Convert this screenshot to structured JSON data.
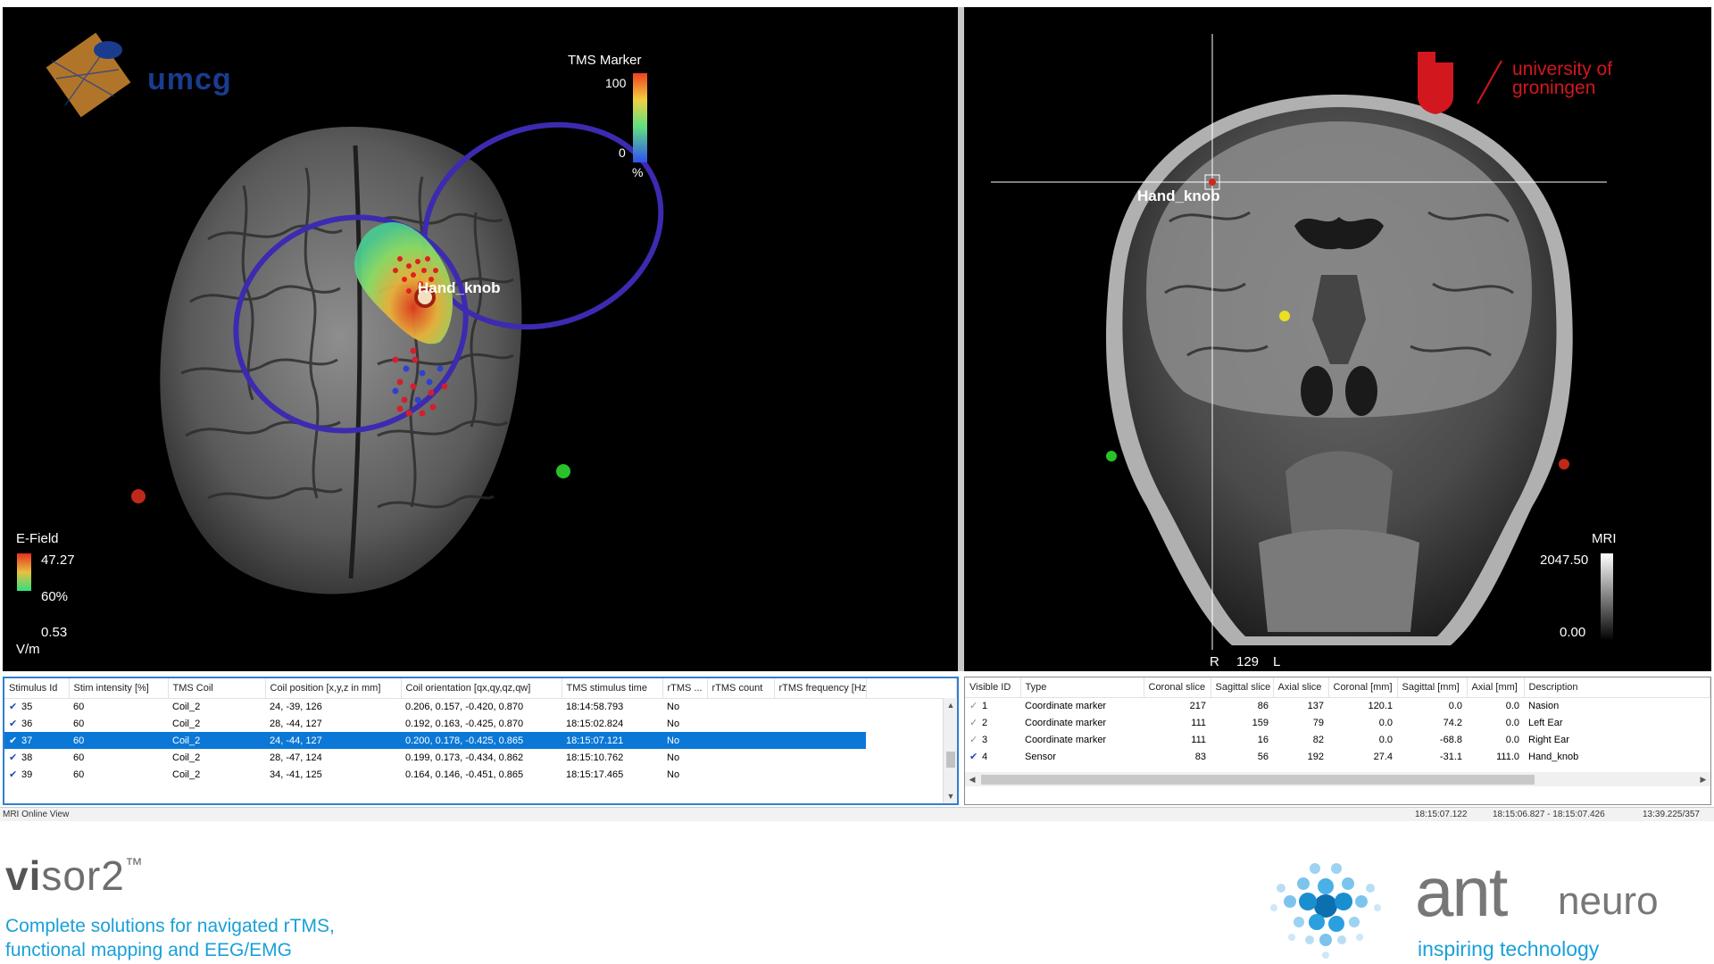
{
  "left_view": {
    "logo_text": "umcg",
    "tms_marker": {
      "title": "TMS Marker",
      "max": "100",
      "min": "0",
      "unit": "%"
    },
    "efield": {
      "title": "E-Field",
      "max": "47.27",
      "mid": "60%",
      "min": "0.53",
      "unit": "V/m"
    },
    "target_label": "Hand_knob"
  },
  "right_view": {
    "logo_line1": "university of",
    "logo_line2": "groningen",
    "target_label": "Hand_knob",
    "mri_scale": {
      "title": "MRI",
      "max": "2047.50",
      "min": "0.00"
    },
    "slice_readout": {
      "left": "R",
      "value": "129",
      "right": "L"
    }
  },
  "stimulus_table": {
    "columns": [
      "Stimulus Id",
      "Stim intensity [%]",
      "TMS Coil",
      "Coil position [x,y,z in mm]",
      "Coil orientation [qx,qy,qz,qw]",
      "TMS stimulus time",
      "rTMS ...",
      "rTMS count",
      "rTMS frequency [Hz]"
    ],
    "rows": [
      {
        "id": "35",
        "intensity": "60",
        "coil": "Coil_2",
        "position": "24, -39, 126",
        "orientation": "0.206, 0.157, -0.420, 0.870",
        "time": "18:14:58.793",
        "rtms": "No"
      },
      {
        "id": "36",
        "intensity": "60",
        "coil": "Coil_2",
        "position": "28, -44, 127",
        "orientation": "0.192, 0.163, -0.425, 0.870",
        "time": "18:15:02.824",
        "rtms": "No"
      },
      {
        "id": "37",
        "intensity": "60",
        "coil": "Coil_2",
        "position": "24, -44, 127",
        "orientation": "0.200, 0.178, -0.425, 0.865",
        "time": "18:15:07.121",
        "rtms": "No"
      },
      {
        "id": "38",
        "intensity": "60",
        "coil": "Coil_2",
        "position": "28, -47, 124",
        "orientation": "0.199, 0.173, -0.434, 0.862",
        "time": "18:15:10.762",
        "rtms": "No"
      },
      {
        "id": "39",
        "intensity": "60",
        "coil": "Coil_2",
        "position": "34, -41, 125",
        "orientation": "0.164, 0.146, -0.451, 0.865",
        "time": "18:15:17.465",
        "rtms": "No"
      }
    ]
  },
  "marker_table": {
    "columns": [
      "Visible ID",
      "Type",
      "Coronal slice",
      "Sagittal slice",
      "Axial slice",
      "Coronal [mm]",
      "Sagittal [mm]",
      "Axial [mm]",
      "Description"
    ],
    "rows": [
      {
        "id": "1",
        "type": "Coordinate marker",
        "coronal_slice": "217",
        "sagittal_slice": "86",
        "axial_slice": "137",
        "coronal_mm": "120.1",
        "sagittal_mm": "0.0",
        "axial_mm": "0.0",
        "description": "Nasion"
      },
      {
        "id": "2",
        "type": "Coordinate marker",
        "coronal_slice": "111",
        "sagittal_slice": "159",
        "axial_slice": "79",
        "coronal_mm": "0.0",
        "sagittal_mm": "74.2",
        "axial_mm": "0.0",
        "description": "Left Ear"
      },
      {
        "id": "3",
        "type": "Coordinate marker",
        "coronal_slice": "111",
        "sagittal_slice": "16",
        "axial_slice": "82",
        "coronal_mm": "0.0",
        "sagittal_mm": "-68.8",
        "axial_mm": "0.0",
        "description": "Right Ear"
      },
      {
        "id": "4",
        "type": "Sensor",
        "coronal_slice": "83",
        "sagittal_slice": "56",
        "axial_slice": "192",
        "coronal_mm": "27.4",
        "sagittal_mm": "-31.1",
        "axial_mm": "111.0",
        "description": "Hand_knob"
      }
    ]
  },
  "statusbar": {
    "left": "MRI Online View",
    "time1": "18:15:07.122",
    "time2": "18:15:06.827 - 18:15:07.426",
    "time3": "13:39.225/357"
  },
  "branding": {
    "product_vi": "vi",
    "product_rest": "sor2",
    "trademark": "™",
    "tagline_line1": "Complete solutions for navigated rTMS,",
    "tagline_line2": "functional mapping and EEG/EMG",
    "company_ant": "ant",
    "company_neuro": "neuro",
    "company_tagline": "inspiring technology"
  },
  "colors": {
    "selection": "#0b78d7",
    "coil_ring": "#3c2bb0",
    "umcg_blue": "#1a3c8f",
    "rug_red": "#d2171f",
    "brand_blue": "#1aa0d8"
  }
}
